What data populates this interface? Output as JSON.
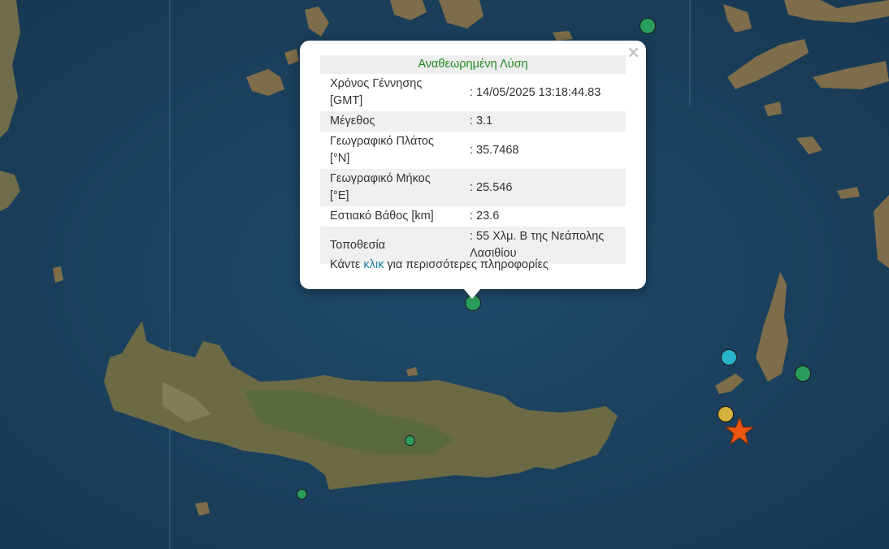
{
  "map": {
    "markers": [
      {
        "name": "event-marker-north",
        "color": "#2a9d5c"
      },
      {
        "name": "event-marker-selected",
        "color": "#2a9d5c"
      },
      {
        "name": "event-marker-east",
        "color": "#2a9d5c"
      },
      {
        "name": "event-marker-cyan",
        "color": "#27b3c9"
      },
      {
        "name": "event-marker-yellow",
        "color": "#d4b13a"
      },
      {
        "name": "event-marker-crete",
        "color": "#2a9d5c"
      },
      {
        "name": "event-marker-southwest",
        "color": "#2a9d5c"
      }
    ],
    "latest_event_color": "#e8560f"
  },
  "popup": {
    "title": "Αναθεωρημένη Λύση",
    "rows": [
      {
        "label": "Χρόνος Γέννησης [GMT]",
        "value": ": 14/05/2025 13:18:44.83"
      },
      {
        "label": "Μέγεθος",
        "value": ": 3.1"
      },
      {
        "label": "Γεωγραφικό Πλάτος [°N]",
        "value": ": 35.7468"
      },
      {
        "label": "Γεωγραφικό Μήκος [°E]",
        "value": ": 25.546"
      },
      {
        "label": "Εστιακό Βάθος [km]",
        "value": ": 23.6"
      },
      {
        "label": "Τοποθεσία",
        "value": ": 55 Χλμ. Β της Νεάπολης Λασιθίου"
      }
    ],
    "footer_prefix": "Κάντε",
    "footer_link": "κλικ",
    "footer_suffix": "για περισσότερες πληροφορίες",
    "close_glyph": "×"
  }
}
